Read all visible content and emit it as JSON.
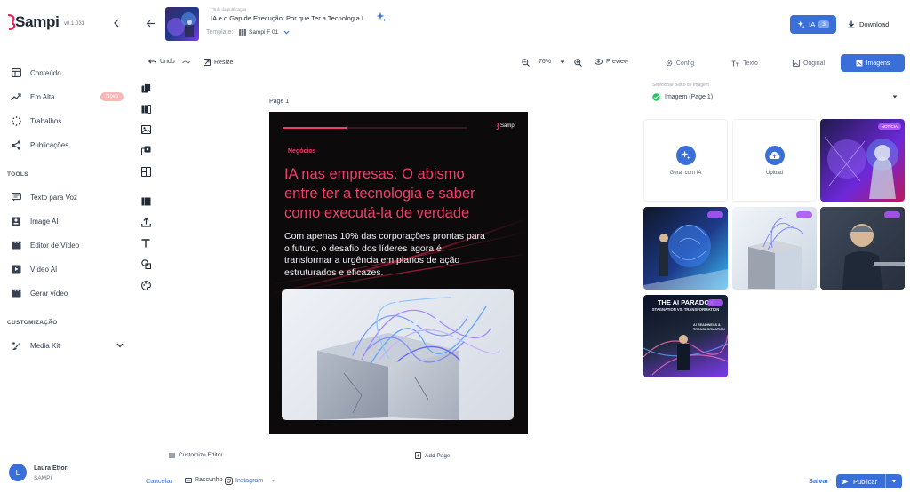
{
  "app": {
    "name": "Sampi",
    "version": "v0.1.031"
  },
  "sidebar": {
    "items": [
      {
        "label": "Conteúdo",
        "icon": "layout-icon"
      },
      {
        "label": "Em Alta",
        "icon": "trending-icon",
        "badge": "Novo"
      },
      {
        "label": "Trabalhos",
        "icon": "sparkle-dots-icon"
      },
      {
        "label": "Publicações",
        "icon": "share-icon"
      }
    ],
    "tools_title": "TOOLS",
    "tools": [
      {
        "label": "Texto para Voz",
        "icon": "speech-icon"
      },
      {
        "label": "Image AI",
        "icon": "image-ai-icon"
      },
      {
        "label": "Editor de Vídeo",
        "icon": "clapper-icon"
      },
      {
        "label": "Vídeo AI",
        "icon": "video-ai-icon"
      },
      {
        "label": "Gerar vídeo",
        "icon": "clapper-icon"
      }
    ],
    "custom_title": "CUSTOMIZAÇÃO",
    "custom": [
      {
        "label": "Media Kit",
        "icon": "palette-brush-icon"
      }
    ],
    "user": {
      "initial": "L",
      "name": "Laura Ettori",
      "org": "SAMPI"
    }
  },
  "header": {
    "small_label": "Título da publicação",
    "doc_title": "IA e o Gap de Execução: Por que Ter a Tecnologia I",
    "template_label": "Template:",
    "template_value": "Sampi F 01",
    "ia_label": "IA",
    "ia_count": "3",
    "download_label": "Download"
  },
  "toolbar": {
    "undo": "Undo",
    "resize": "Resize",
    "zoom": "76%",
    "preview": "Preview"
  },
  "canvas": {
    "page_label": "Page 1",
    "customize_label": "Customize Editor",
    "add_page_label": "Add Page"
  },
  "poster": {
    "brand": "Sampi",
    "category": "Negócios",
    "title_lines": [
      "IA nas empresas: O abismo",
      "entre ter a tecnologia e saber",
      "como executá-la de verdade"
    ],
    "subtitle_lines": [
      "Com apenas 10% das corporações prontas para",
      "o futuro, o desafio dos líderes agora é",
      "transformar a urgência em planos de ação",
      "estruturados e eficazes."
    ]
  },
  "right_panel": {
    "tabs": [
      {
        "label": "Config",
        "icon": "gear-icon"
      },
      {
        "label": "Texto",
        "icon": "text-icon"
      },
      {
        "label": "Original",
        "icon": "image-icon"
      },
      {
        "label": "Imagens",
        "icon": "images-icon",
        "active": true
      }
    ],
    "select_label": "Selecionar Bloco de Imagem",
    "select_value": "Imagem (Page 1)",
    "gen_ai_label": "Gerar com IA",
    "upload_label": "Upload",
    "tile_badge": "NOTÍCIA",
    "paradox_line1": "THE AI PARADOX",
    "paradox_line2": "STAGNATION VS. TRANSFORMATION",
    "paradox_line3": "AI READINESS & TRANSFORMATION"
  },
  "footer": {
    "cancel": "Cancelar",
    "draft": "Rascunho",
    "instagram": "Instagram",
    "save": "Salvar",
    "publish": "Publicar"
  },
  "colors": {
    "accent": "#3b6fd8",
    "poster_red": "#ee3e6b",
    "poster_bg": "#0d0a0c",
    "brand_red": "#e0225a"
  }
}
